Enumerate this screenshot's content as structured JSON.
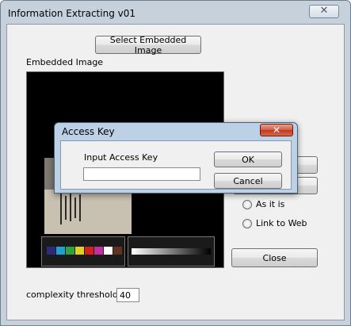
{
  "main_window": {
    "title": "Information Extracting v01",
    "close_glyph": "✕",
    "select_button": "Select Embedded Image",
    "image_label": "Embedded Image",
    "options": [
      "As it is",
      "Link to Web"
    ],
    "close_button": "Close",
    "threshold_label": "complexity threshold",
    "threshold_value": "40"
  },
  "dialog": {
    "title": "Access Key",
    "close_glyph": "✕",
    "input_label": "Input Access Key",
    "input_value": "",
    "ok_button": "OK",
    "cancel_button": "Cancel"
  },
  "colors": {
    "window_frame": "#c7d1dc",
    "dialog_frame": "#bcd0e6",
    "client_bg": "#f0f0f0",
    "close_red": "#c23520"
  }
}
